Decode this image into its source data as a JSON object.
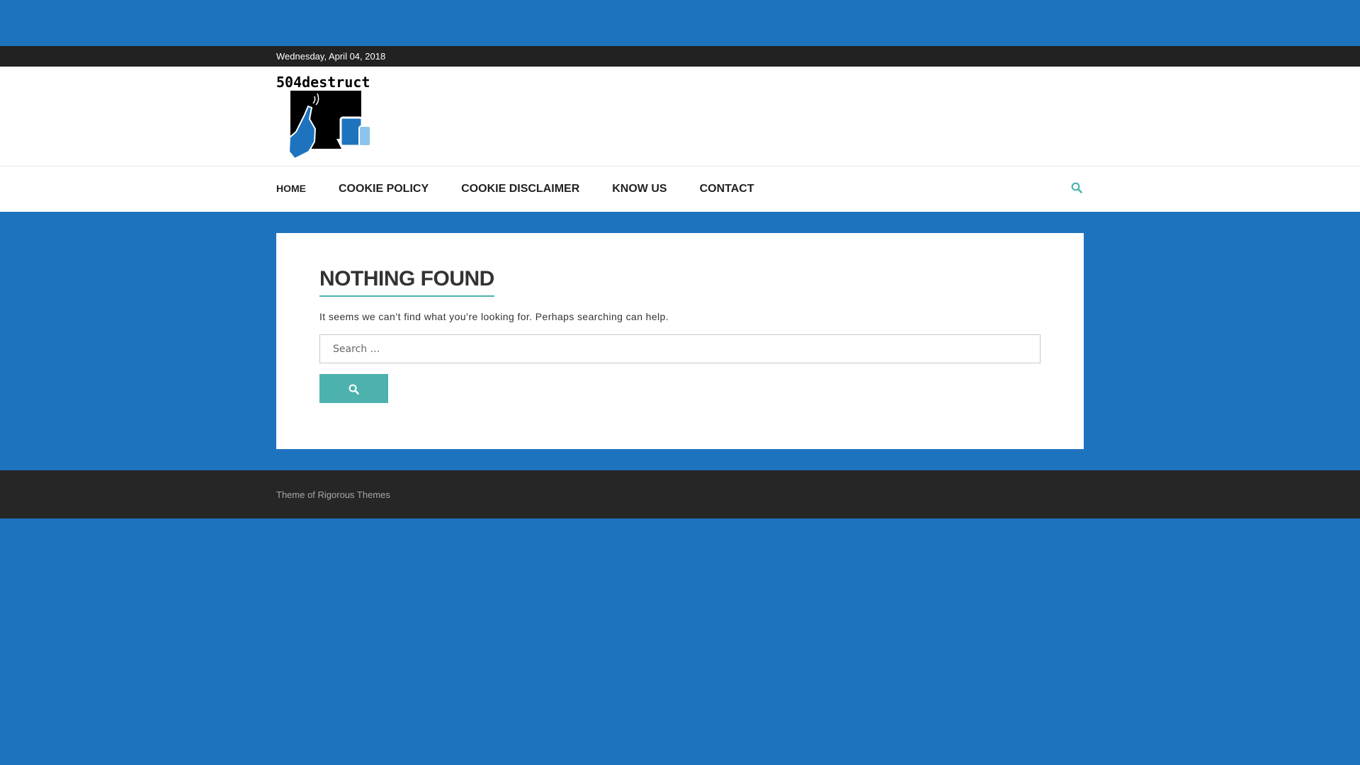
{
  "top_bar": {
    "date": "Wednesday, April 04, 2018"
  },
  "header": {
    "logo_text": "504destruct"
  },
  "nav": {
    "items": [
      {
        "label": "HOME"
      },
      {
        "label": "COOKIE POLICY"
      },
      {
        "label": "COOKIE DISCLAIMER"
      },
      {
        "label": "KNOW US"
      },
      {
        "label": "CONTACT"
      }
    ],
    "search_icon": "search-icon"
  },
  "main": {
    "title": "NOTHING FOUND",
    "message": "It seems we can’t find what you’re looking for. Perhaps searching can help.",
    "search": {
      "placeholder": "Search …",
      "value": "",
      "submit_icon": "search-icon"
    }
  },
  "footer": {
    "prefix": "Theme of ",
    "link": "Rigorous Themes"
  },
  "colors": {
    "background": "#1e73be",
    "accent": "#4db2ae",
    "top_bar": "#222222",
    "footer": "#262626"
  }
}
